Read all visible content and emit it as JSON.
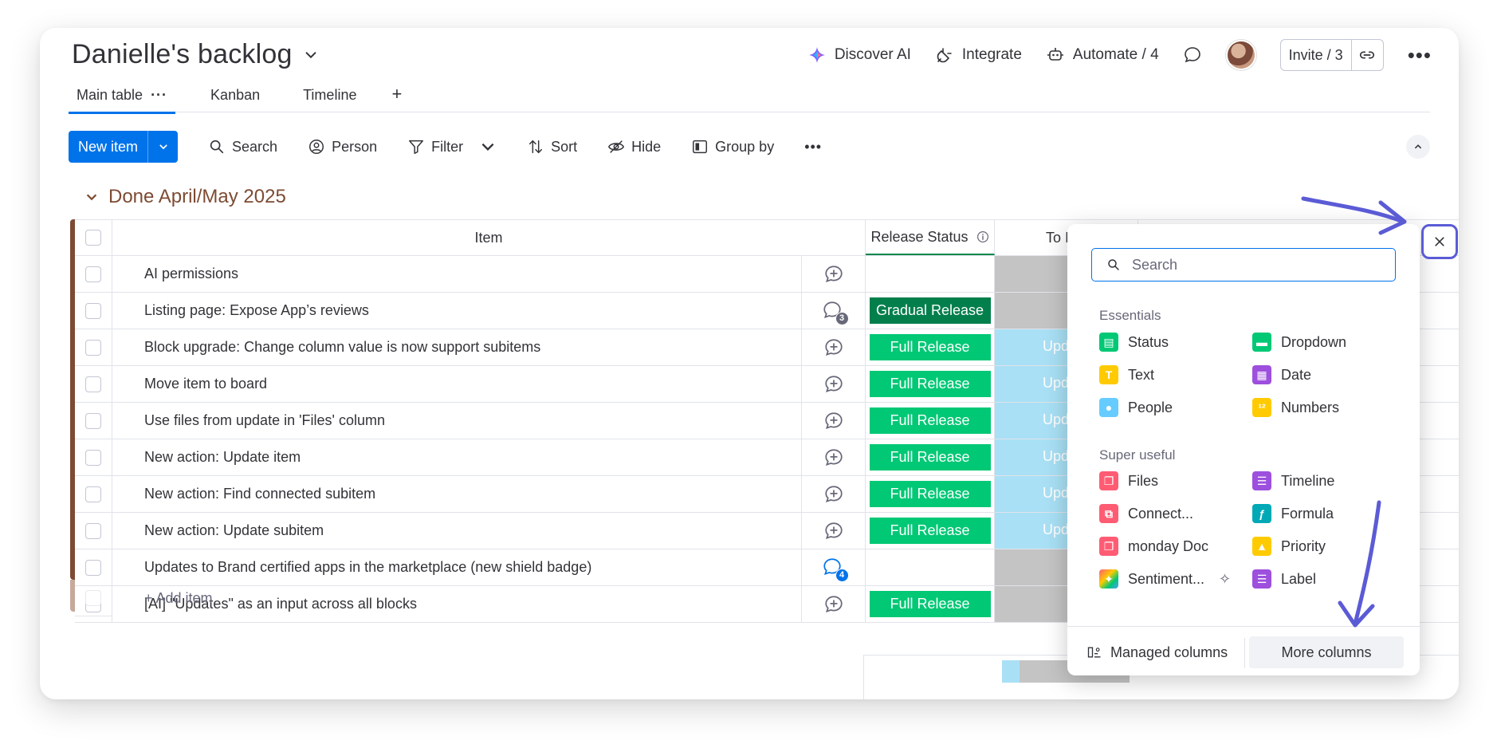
{
  "board": {
    "title": "Danielle's backlog"
  },
  "header": {
    "discover_ai": "Discover AI",
    "integrate": "Integrate",
    "automate": "Automate / 4",
    "invite": "Invite / 3"
  },
  "tabs": [
    {
      "label": "Main table"
    },
    {
      "label": "Kanban"
    },
    {
      "label": "Timeline"
    }
  ],
  "toolbar": {
    "new_item": "New item",
    "search": "Search",
    "person": "Person",
    "filter": "Filter",
    "sort": "Sort",
    "hide": "Hide",
    "group_by": "Group by"
  },
  "group": {
    "title": "Done April/May 2025",
    "color": "#7d4b33"
  },
  "columns": {
    "item": "Item",
    "release_status": "Release Status",
    "to": "To I"
  },
  "rows": [
    {
      "name": "AI permissions",
      "status": "",
      "to": "",
      "updates": ""
    },
    {
      "name": "Listing page: Expose App’s reviews",
      "status": "Gradual Release",
      "to": "",
      "updates": "3"
    },
    {
      "name": "Block upgrade: Change column value is now support subitems",
      "status": "Full Release",
      "to": "Upd",
      "updates": ""
    },
    {
      "name": "Move item to board",
      "status": "Full Release",
      "to": "Upd",
      "updates": ""
    },
    {
      "name": "Use files from update in 'Files' column",
      "status": "Full Release",
      "to": "Upd",
      "updates": ""
    },
    {
      "name": "New action: Update item",
      "status": "Full Release",
      "to": "Upd",
      "updates": ""
    },
    {
      "name": "New action: Find connected subitem",
      "status": "Full Release",
      "to": "Upd",
      "updates": ""
    },
    {
      "name": "New action: Update subitem",
      "status": "Full Release",
      "to": "Upd",
      "updates": ""
    },
    {
      "name": "Updates to Brand certified apps in the marketplace (new shield badge)",
      "status": "",
      "to": "",
      "updates": "4"
    },
    {
      "name": "[AI] \"Updates\" as an input across all blocks",
      "status": "Full Release",
      "to": "",
      "updates": ""
    }
  ],
  "add_item": "+ Add item",
  "popup": {
    "search_placeholder": "Search",
    "essentials_label": "Essentials",
    "essentials": [
      {
        "label": "Status",
        "icon": "status-icon",
        "color": "#00c875"
      },
      {
        "label": "Dropdown",
        "icon": "dropdown-icon",
        "color": "#00c875"
      },
      {
        "label": "Text",
        "icon": "text-icon",
        "color": "#ffcb00"
      },
      {
        "label": "Date",
        "icon": "date-icon",
        "color": "#9d50dd"
      },
      {
        "label": "People",
        "icon": "people-icon",
        "color": "#66ccff"
      },
      {
        "label": "Numbers",
        "icon": "numbers-icon",
        "color": "#ffcb00"
      }
    ],
    "super_useful_label": "Super useful",
    "super_useful": [
      {
        "label": "Files",
        "icon": "files-icon",
        "color": "#ff5c74"
      },
      {
        "label": "Timeline",
        "icon": "timeline-icon",
        "color": "#9d50dd"
      },
      {
        "label": "Connect...",
        "icon": "connect-icon",
        "color": "#ff5c74"
      },
      {
        "label": "Formula",
        "icon": "formula-icon",
        "color": "#00a9b5"
      },
      {
        "label": "monday Doc",
        "icon": "doc-icon",
        "color": "#ff5c74"
      },
      {
        "label": "Priority",
        "icon": "priority-icon",
        "color": "#ffcb00"
      },
      {
        "label": "Sentiment...",
        "icon": "sentiment-icon",
        "color": "#ff9f1c"
      },
      {
        "label": "Label",
        "icon": "label-icon",
        "color": "#9d50dd"
      }
    ],
    "managed_columns": "Managed columns",
    "more_columns": "More columns"
  },
  "colors": {
    "primary": "#0073ea",
    "full_release": "#00c875",
    "gradual_release": "#037f4c",
    "annotation": "#5b5bd6"
  }
}
